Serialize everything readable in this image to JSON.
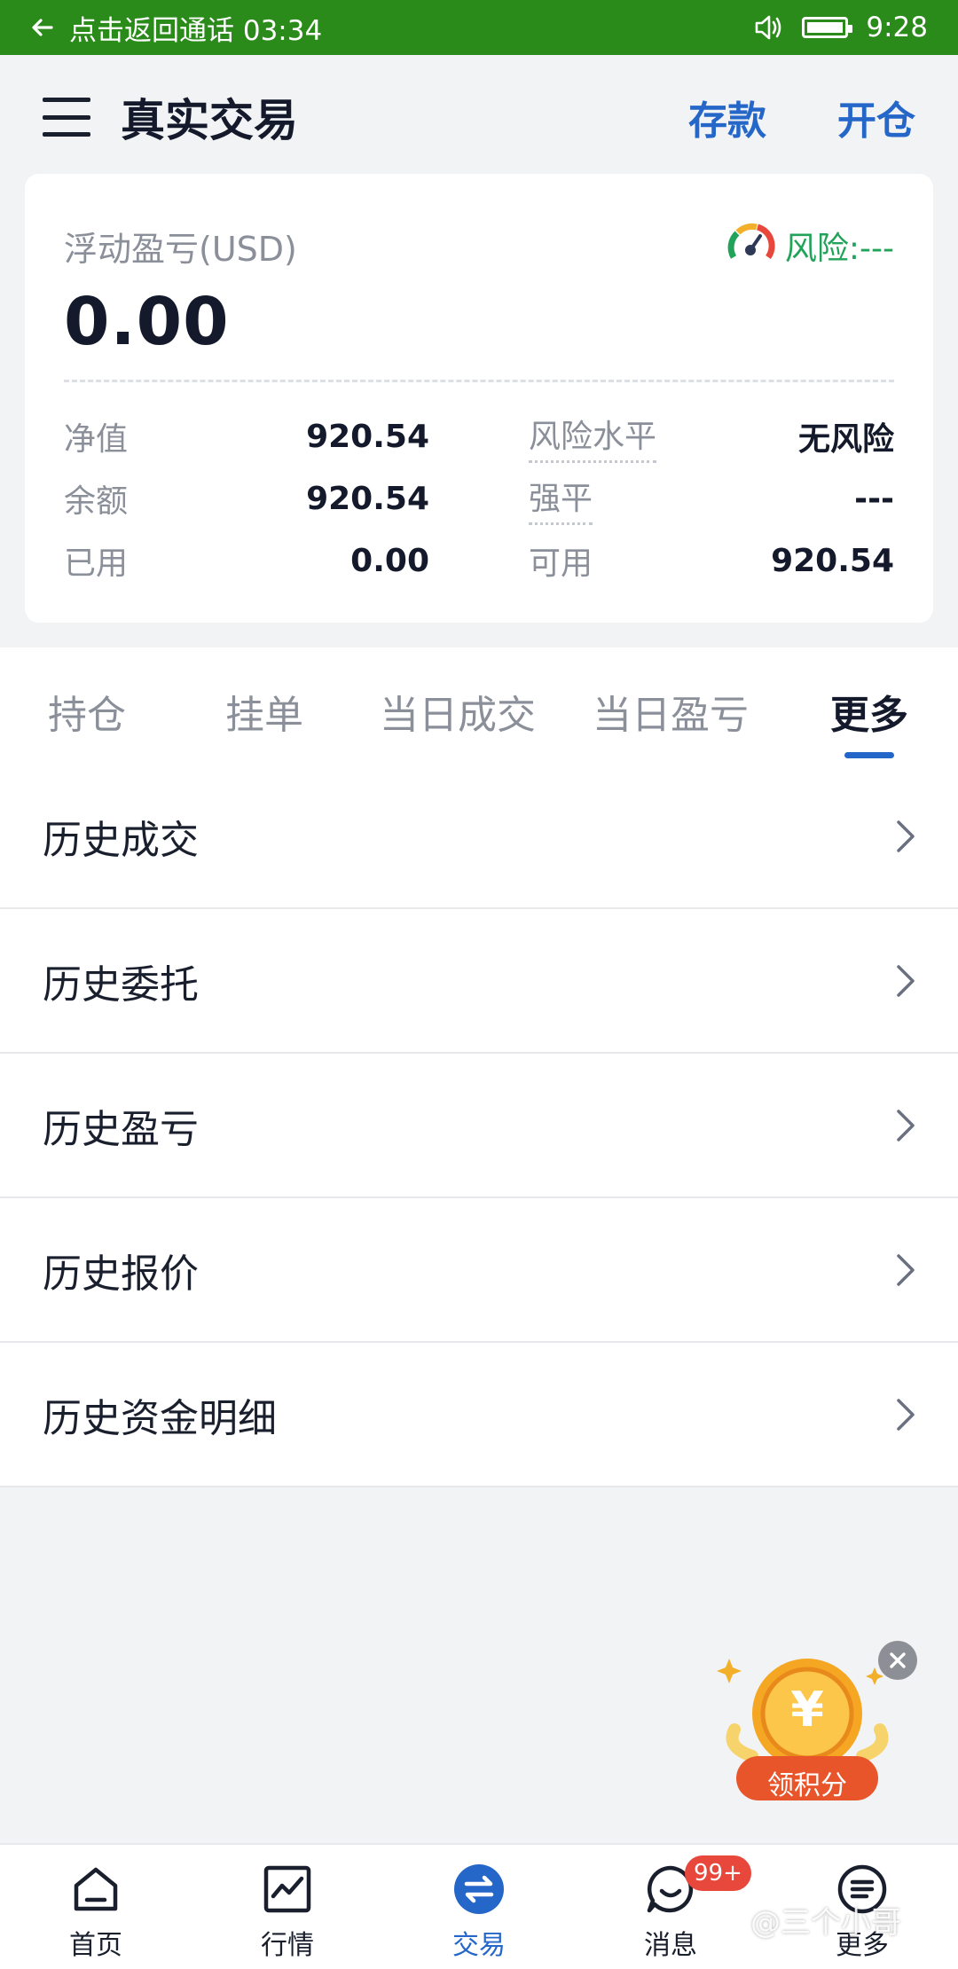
{
  "status_bar": {
    "call_text": "点击返回通话 03:34",
    "time": "9:28",
    "bg_color": "#2a8a1a"
  },
  "header": {
    "title": "真实交易",
    "deposit": "存款",
    "open_position": "开仓"
  },
  "account": {
    "float_label": "浮动盈亏(USD)",
    "float_value": "0.00",
    "risk_label": "风险:---",
    "stats_left": [
      {
        "label": "净值",
        "value": "920.54"
      },
      {
        "label": "余额",
        "value": "920.54"
      },
      {
        "label": "已用",
        "value": "0.00"
      }
    ],
    "stats_right": [
      {
        "label": "风险水平",
        "value": "无风险"
      },
      {
        "label": "强平",
        "value": "---"
      },
      {
        "label": "可用",
        "value": "920.54"
      }
    ]
  },
  "tabs": [
    {
      "label": "持仓"
    },
    {
      "label": "挂单"
    },
    {
      "label": "当日成交"
    },
    {
      "label": "当日盈亏"
    },
    {
      "label": "更多",
      "active": true
    }
  ],
  "history_items": [
    {
      "label": "历史成交"
    },
    {
      "label": "历史委托"
    },
    {
      "label": "历史盈亏"
    },
    {
      "label": "历史报价"
    },
    {
      "label": "历史资金明细"
    }
  ],
  "promo": {
    "button_text": "领积分",
    "coin_symbol": "¥"
  },
  "bottom_nav": [
    {
      "label": "首页",
      "icon": "home-icon"
    },
    {
      "label": "行情",
      "icon": "chart-icon"
    },
    {
      "label": "交易",
      "icon": "exchange-icon",
      "active": true
    },
    {
      "label": "消息",
      "icon": "message-icon",
      "badge": "99+"
    },
    {
      "label": "更多",
      "icon": "more-icon"
    }
  ],
  "watermark": "@三个小哥",
  "colors": {
    "accent": "#2566c9",
    "risk_green": "#22a35a",
    "badge_red": "#e8473b"
  }
}
